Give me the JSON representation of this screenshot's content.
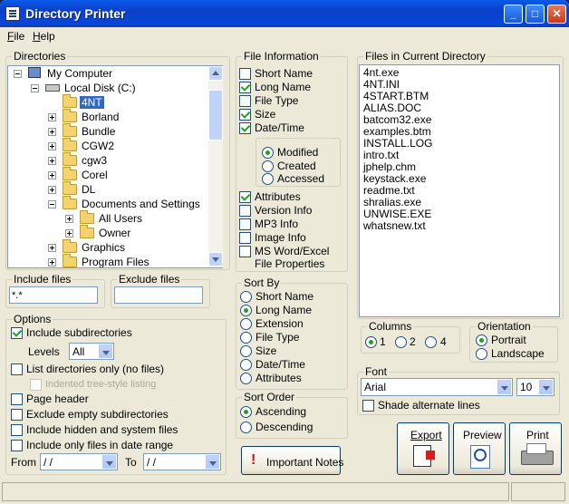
{
  "window": {
    "title": "Directory Printer"
  },
  "menu": [
    {
      "label": "File",
      "key": "F",
      "rest": "ile"
    },
    {
      "label": "Help",
      "key": "H",
      "rest": "elp"
    }
  ],
  "directories": {
    "legend": "Directories",
    "tree": [
      {
        "label": "My Computer",
        "level": 0,
        "icon": "computer-icon",
        "expander": "minus"
      },
      {
        "label": "Local Disk (C:)",
        "level": 1,
        "icon": "drive-icon",
        "expander": "minus"
      },
      {
        "label": "4NT",
        "level": 2,
        "icon": "folder-icon",
        "expander": "",
        "selected": true
      },
      {
        "label": "Borland",
        "level": 2,
        "icon": "folder-icon",
        "expander": "plus"
      },
      {
        "label": "Bundle",
        "level": 2,
        "icon": "folder-icon",
        "expander": "plus"
      },
      {
        "label": "CGW2",
        "level": 2,
        "icon": "folder-icon",
        "expander": "plus"
      },
      {
        "label": "cgw3",
        "level": 2,
        "icon": "folder-icon",
        "expander": "plus"
      },
      {
        "label": "Corel",
        "level": 2,
        "icon": "folder-icon",
        "expander": "plus"
      },
      {
        "label": "DL",
        "level": 2,
        "icon": "folder-icon",
        "expander": "plus"
      },
      {
        "label": "Documents and Settings",
        "level": 2,
        "icon": "folder-icon",
        "expander": "minus"
      },
      {
        "label": "All Users",
        "level": 3,
        "icon": "folder-icon",
        "expander": "plus"
      },
      {
        "label": "Owner",
        "level": 3,
        "icon": "folder-icon",
        "expander": "plus"
      },
      {
        "label": "Graphics",
        "level": 2,
        "icon": "folder-icon",
        "expander": "plus"
      },
      {
        "label": "Program Files",
        "level": 2,
        "icon": "folder-icon",
        "expander": "plus"
      }
    ]
  },
  "include_files": {
    "legend": "Include files",
    "value": "*.*"
  },
  "exclude_files": {
    "legend": "Exclude files",
    "value": ""
  },
  "options": {
    "legend": "Options",
    "include_subdirectories": "Include subdirectories",
    "levels_label": "Levels",
    "levels_value": "All",
    "list_dirs_only": "List directories only (no files)",
    "indented_tree": "Indented tree-style listing",
    "page_header": "Page header",
    "exclude_empty": "Exclude empty subdirectories",
    "include_hidden": "Include hidden and system files",
    "include_date_range": "Include only files in date range",
    "from_label": "From",
    "from_value": " / /",
    "to_label": "To",
    "to_value": " / /"
  },
  "file_information": {
    "legend": "File Information",
    "short_name": "Short Name",
    "long_name": "Long Name",
    "file_type": "File Type",
    "size": "Size",
    "date_time": "Date/Time",
    "modified": "Modified",
    "created": "Created",
    "accessed": "Accessed",
    "attributes": "Attributes",
    "version_info": "Version Info",
    "mp3_info": "MP3 Info",
    "image_info": "Image Info",
    "ms_word_excel_1": "MS Word/Excel",
    "ms_word_excel_2": "File Properties"
  },
  "sort_by": {
    "legend": "Sort By",
    "options": [
      "Short Name",
      "Long Name",
      "Extension",
      "File Type",
      "Size",
      "Date/Time",
      "Attributes"
    ],
    "selected_index": 1
  },
  "sort_order": {
    "legend": "Sort Order",
    "ascending": "Ascending",
    "descending": "Descending"
  },
  "important_notes": {
    "label": "Important Notes"
  },
  "files_in_current_directory": {
    "legend": "Files in Current Directory",
    "files": [
      "4nt.exe",
      "4NT.INI",
      "4START.BTM",
      "ALIAS.DOC",
      "batcom32.exe",
      "examples.btm",
      "INSTALL.LOG",
      "intro.txt",
      "jphelp.chm",
      "keystack.exe",
      "readme.txt",
      "shralias.exe",
      "UNWISE.EXE",
      "whatsnew.txt"
    ]
  },
  "columns": {
    "legend": "Columns",
    "options": [
      "1",
      "2",
      "4"
    ],
    "selected_index": 0
  },
  "orientation": {
    "legend": "Orientation",
    "portrait": "Portrait",
    "landscape": "Landscape"
  },
  "font": {
    "legend": "Font",
    "name": "Arial",
    "size": "10",
    "shade_alternate": "Shade alternate lines"
  },
  "actions": {
    "export": "Export",
    "preview": "Preview",
    "print": "Print"
  },
  "colors": {
    "title_blue": "#0a4ad8",
    "selection": "#316ac5",
    "check_green": "#21a121"
  }
}
